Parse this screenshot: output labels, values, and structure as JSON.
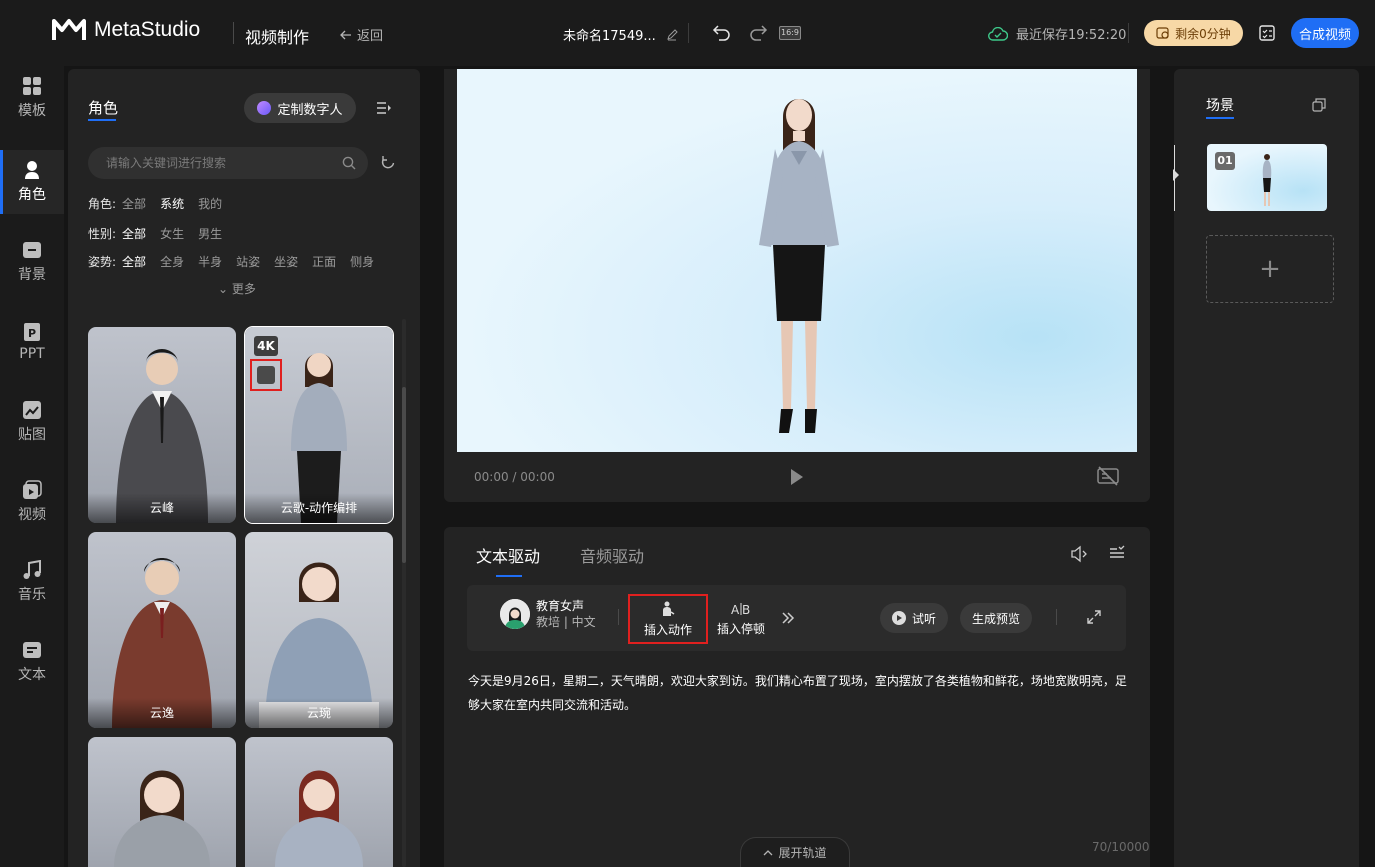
{
  "header": {
    "brand": "MetaStudio",
    "page_title": "视频制作",
    "back_label": "返回",
    "doc_name": "未命名17549...",
    "aspect_ratio": "16:9",
    "save_status": "最近保存19:52:20",
    "remain_label": "剩余0分钟",
    "compose_label": "合成视频"
  },
  "rail": {
    "items": [
      {
        "label": "模板",
        "icon": "template-icon"
      },
      {
        "label": "角色",
        "icon": "role-icon",
        "active": true
      },
      {
        "label": "背景",
        "icon": "background-icon"
      },
      {
        "label": "PPT",
        "icon": "ppt-icon"
      },
      {
        "label": "贴图",
        "icon": "sticker-icon"
      },
      {
        "label": "视频",
        "icon": "video-icon"
      },
      {
        "label": "音乐",
        "icon": "music-icon"
      },
      {
        "label": "文本",
        "icon": "text-icon"
      }
    ]
  },
  "roles": {
    "tab": "角色",
    "custom_btn": "定制数字人",
    "search_placeholder": "请输入关键词进行搜索",
    "filters": [
      {
        "label": "角色:",
        "options": [
          "全部",
          "系统",
          "我的"
        ],
        "selected": "系统"
      },
      {
        "label": "性别:",
        "options": [
          "全部",
          "女生",
          "男生"
        ],
        "selected": "全部"
      },
      {
        "label": "姿势:",
        "options": [
          "全部",
          "全身",
          "半身",
          "站姿",
          "坐姿",
          "正面",
          "侧身"
        ],
        "selected": "全部"
      }
    ],
    "more_label": "更多",
    "cards": [
      {
        "name": "云峰"
      },
      {
        "name": "云歌-动作编排",
        "badge": "4K"
      },
      {
        "name": "云逸"
      },
      {
        "name": "云琬"
      },
      {
        "name": ""
      },
      {
        "name": ""
      }
    ]
  },
  "player": {
    "time": "00:00 / 00:00"
  },
  "scenes": {
    "tab": "场景",
    "items": [
      {
        "num": "01"
      }
    ],
    "add_label": "+"
  },
  "editor": {
    "tabs": [
      "文本驱动",
      "音频驱动"
    ],
    "active_tab": "文本驱动",
    "voice_name": "教育女声",
    "voice_sub": "教培 | 中文",
    "insert_action": "插入动作",
    "insert_pause": "插入停顿",
    "try_label": "试听",
    "preview_label": "生成预览",
    "script_text": "今天是9月26日，星期二，天气晴朗，欢迎大家到访。我们精心布置了现场，室内摆放了各类植物和鲜花，场地宽敞明亮，足够大家在室内共同交流和活动。",
    "counter": "70/10000",
    "expand_track": "展开轨道"
  },
  "colors": {
    "accent": "#1f6ef5",
    "highlight_box": "#e0201f",
    "remain_bg": "#f7d8a6",
    "panel_bg": "#232323"
  }
}
